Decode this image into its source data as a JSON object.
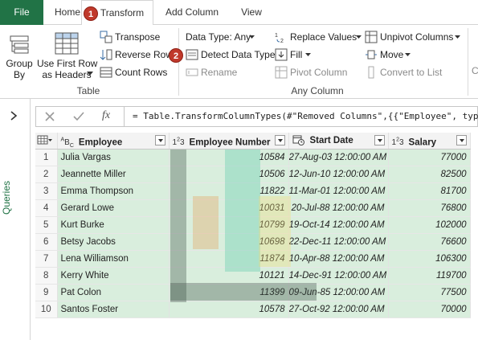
{
  "tabs": {
    "file": "File",
    "home": "Home",
    "transform": "Transform",
    "add_column": "Add Column",
    "view": "View"
  },
  "callouts": {
    "first": "1",
    "second": "2"
  },
  "ribbon": {
    "group_by": "Group\nBy",
    "use_first_row": "Use First Row\nas Headers",
    "transpose": "Transpose",
    "reverse_rows": "Reverse Rows",
    "count_rows": "Count Rows",
    "table_group": "Table",
    "data_type": "Data Type: Any",
    "detect_data_type": "Detect Data Type",
    "rename": "Rename",
    "replace_values": "Replace Values",
    "fill": "Fill",
    "pivot_column": "Pivot Column",
    "unpivot_columns": "Unpivot Columns",
    "move": "Move",
    "convert_to_list": "Convert to List",
    "any_column_group": "Any Column",
    "next_group_stub": "C"
  },
  "queries_pane": {
    "label": "Queries"
  },
  "formula_bar": {
    "fx": "fx",
    "formula": "= Table.TransformColumnTypes(#\"Removed Columns\",{{\"Employee\", type"
  },
  "grid": {
    "columns": [
      {
        "type_icon": "ABC",
        "name": "Employee"
      },
      {
        "type_icon": "123",
        "name": "Employee Number"
      },
      {
        "type_icon": "calendar-clock",
        "name": "Start Date"
      },
      {
        "type_icon": "123",
        "name": "Salary"
      }
    ],
    "rows": [
      {
        "n": "1",
        "employee": "Julia Vargas",
        "number": "10584",
        "start": "27-Aug-03 12:00:00 AM",
        "salary": "77000"
      },
      {
        "n": "2",
        "employee": "Jeannette Miller",
        "number": "10506",
        "start": "12-Jun-10 12:00:00 AM",
        "salary": "82500"
      },
      {
        "n": "3",
        "employee": "Emma Thompson",
        "number": "11822",
        "start": "11-Mar-01 12:00:00 AM",
        "salary": "81700"
      },
      {
        "n": "4",
        "employee": "Gerard Lowe",
        "number": "10031",
        "start": "20-Jul-88 12:00:00 AM",
        "salary": "76800"
      },
      {
        "n": "5",
        "employee": "Kurt Burke",
        "number": "10799",
        "start": "19-Oct-14 12:00:00 AM",
        "salary": "102000"
      },
      {
        "n": "6",
        "employee": "Betsy Jacobs",
        "number": "10698",
        "start": "22-Dec-11 12:00:00 AM",
        "salary": "76600"
      },
      {
        "n": "7",
        "employee": "Lena Williamson",
        "number": "11874",
        "start": "10-Apr-88 12:00:00 AM",
        "salary": "106300"
      },
      {
        "n": "8",
        "employee": "Kerry White",
        "number": "10121",
        "start": "14-Dec-91 12:00:00 AM",
        "salary": "119700"
      },
      {
        "n": "9",
        "employee": "Pat Colon",
        "number": "11399",
        "start": "09-Jun-85 12:00:00 AM",
        "salary": "77500"
      },
      {
        "n": "10",
        "employee": "Santos Foster",
        "number": "10578",
        "start": "27-Oct-92 12:00:00 AM",
        "salary": "70000"
      }
    ]
  },
  "colors": {
    "excel_green": "#217346",
    "cell_green": "#d9eedd",
    "callout_red": "#c0392b"
  }
}
